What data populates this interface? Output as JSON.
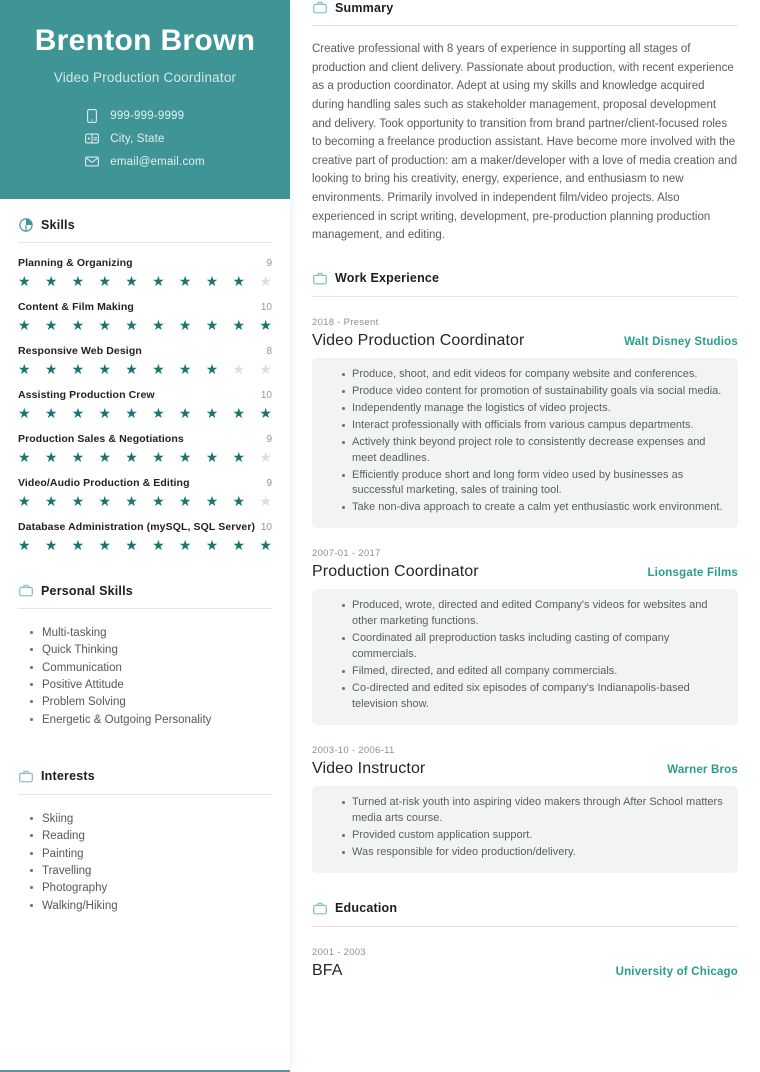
{
  "hero": {
    "name": "Brenton Brown",
    "role": "Video Production Coordinator",
    "contacts": [
      {
        "icon": "phone-icon",
        "value": "999-999-9999"
      },
      {
        "icon": "location-icon",
        "value": "City, State"
      },
      {
        "icon": "email-icon",
        "value": "email@email.com"
      }
    ]
  },
  "sidebar": {
    "skills_section": {
      "icon": "pie-chart-icon",
      "title": "Skills",
      "max": 10,
      "items": [
        {
          "name": "Planning & Organizing",
          "score": 9
        },
        {
          "name": "Content & Film Making",
          "score": 10
        },
        {
          "name": "Responsive Web Design",
          "score": 8
        },
        {
          "name": "Assisting Production Crew",
          "score": 10
        },
        {
          "name": "Production Sales & Negotiations",
          "score": 9
        },
        {
          "name": "Video/Audio Production & Editing",
          "score": 9
        },
        {
          "name": "Database Administration (mySQL, SQL Server)",
          "score": 10
        }
      ]
    },
    "personal_skills_section": {
      "icon": "briefcase-icon",
      "title": "Personal Skills",
      "items": [
        "Multi-tasking",
        "Quick Thinking",
        "Communication",
        "Positive Attitude",
        "Problem Solving",
        "Energetic & Outgoing Personality"
      ]
    },
    "interests_section": {
      "icon": "briefcase-icon",
      "title": "Interests",
      "items": [
        "Skiing",
        "Reading",
        "Painting",
        "Travelling",
        "Photography",
        "Walking/Hiking"
      ]
    }
  },
  "main": {
    "summary_section": {
      "icon": "briefcase-icon",
      "title": "Summary",
      "text": "Creative professional with 8 years of experience in supporting all stages of production and client delivery. Passionate about production, with recent experience as a production coordinator. Adept at using my skills and knowledge acquired during handling sales such as stakeholder management, proposal development and delivery. Took opportunity to transition from brand partner/client-focused roles to becoming a freelance production assistant. Have become more involved with the creative part of production: am a maker/developer with a love of media creation and looking to bring his creativity, energy, experience, and enthusiasm to new environments. Primarily involved in independent film/video projects. Also experienced in script writing, development, pre-production planning production management, and editing."
    },
    "work_section": {
      "icon": "briefcase-icon",
      "title": "Work Experience",
      "jobs": [
        {
          "date": "2018 - Present",
          "title": "Video Production Coordinator",
          "company": "Walt Disney Studios",
          "bullets": [
            "Produce, shoot, and edit videos for company website and conferences.",
            "Produce video content for promotion of sustainability goals via social media.",
            "Independently manage the logistics of video projects.",
            "Interact professionally with officials from various campus departments.",
            "Actively think beyond project role to consistently decrease expenses and meet deadlines.",
            "Efficiently produce short and long form video used by businesses as successful marketing, sales of training tool.",
            "Take non-diva approach to create a calm yet enthusiastic work environment."
          ]
        },
        {
          "date": "2007-01 - 2017",
          "title": "Production Coordinator",
          "company": "Lionsgate Films",
          "bullets": [
            "Produced, wrote, directed and edited Company's videos for websites and other marketing functions.",
            "Coordinated all preproduction tasks including casting of company commercials.",
            "Filmed, directed, and edited all company commercials.",
            "Co-directed and edited six episodes of company's Indianapolis-based television show."
          ]
        },
        {
          "date": "2003-10 - 2006-11",
          "title": "Video Instructor",
          "company": "Warner Bros",
          "bullets": [
            "Turned at-risk youth into aspiring video makers through After School matters media arts course.",
            "Provided custom application support.",
            "Was responsible for video production/delivery."
          ]
        }
      ]
    },
    "education_section": {
      "icon": "briefcase-icon",
      "title": "Education",
      "entries": [
        {
          "date": "2001 - 2003",
          "degree": "BFA",
          "school": "University of Chicago"
        }
      ]
    }
  },
  "colors": {
    "teal_header": "#3f9595",
    "star_on": "#17766d",
    "star_off": "#dcdfe0",
    "company_accent": "#2a9d8a",
    "box_bg": "#f2f4f4",
    "bottom_rule": "#5b93ad"
  }
}
